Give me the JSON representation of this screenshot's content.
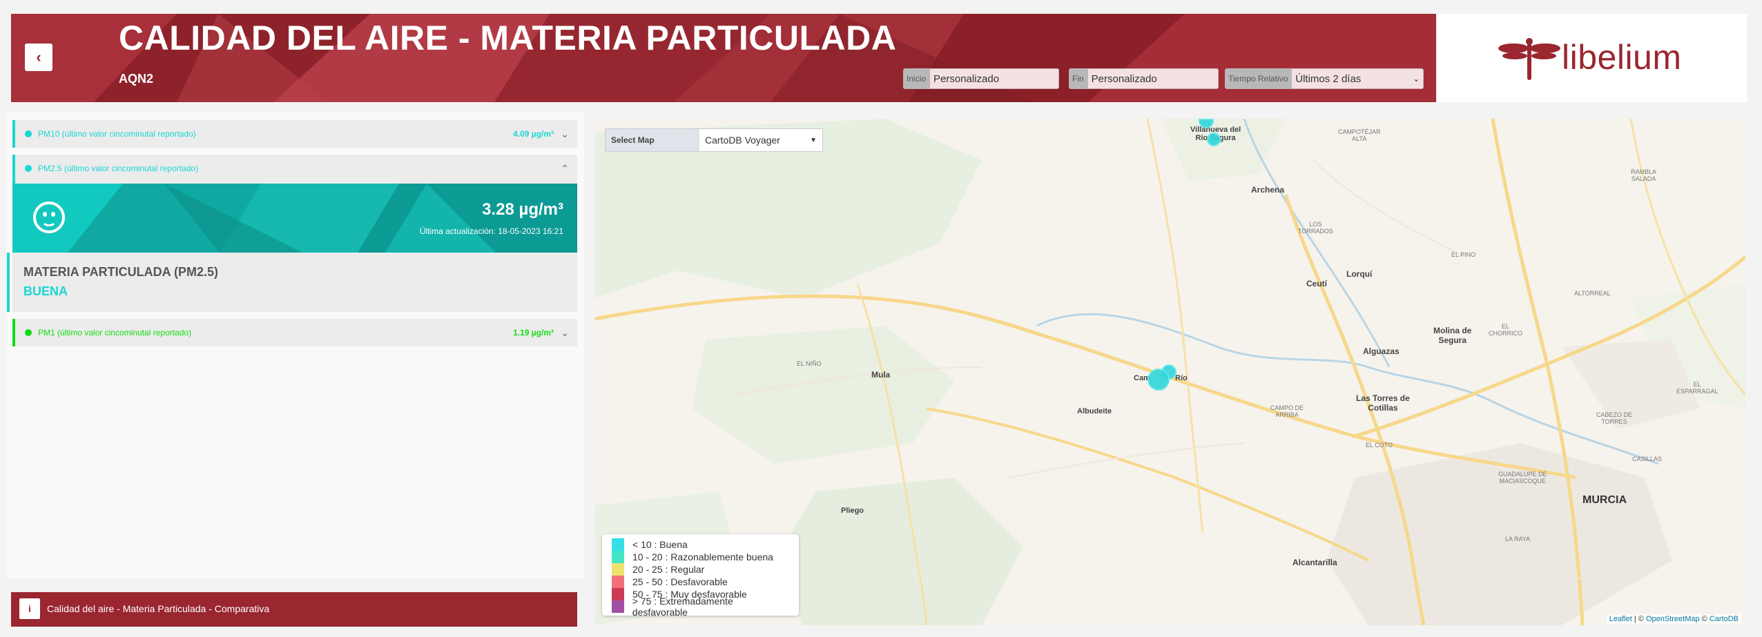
{
  "header": {
    "title": "CALIDAD DEL AIRE - MATERIA PARTICULADA",
    "subtitle": "AQN2",
    "back_icon": "‹",
    "filters": {
      "inicio_label": "Inicio",
      "inicio_value": "Personalizado",
      "fin_label": "Fin",
      "fin_value": "Personalizado",
      "relativo_label": "Tiempo Relativo",
      "relativo_value": "Últimos 2 días"
    }
  },
  "logo": {
    "text": "libelium"
  },
  "panel": {
    "pm10": {
      "label": "PM10 (último valor cincominutal reportado)",
      "value": "4.09 µg/m³",
      "color": "#19d7d2"
    },
    "pm25": {
      "label": "PM2.5 (último valor cincominutal reportado)",
      "value": "3.28 µg/m³",
      "color": "#19d7d2",
      "updated": "Última actualización: 18-05-2023 16:21",
      "info_title": "MATERIA PARTICULADA (PM2.5)",
      "info_status": "BUENA"
    },
    "pm1": {
      "label": "PM1 (último valor cincominutal reportado)",
      "value": "1.19 µg/m³",
      "color": "#11dd11"
    }
  },
  "footer": {
    "text": "Calidad del aire - Materia Particulada - Comparativa",
    "icon": "i"
  },
  "map": {
    "select_label": "Select Map",
    "select_value": "CartoDB Voyager",
    "places": {
      "villanueva": "Villanueva del",
      "riosegura": "Río Segura",
      "archena": "Archena",
      "lostorrados": "LOS\nTORRADOS",
      "lorqui": "Lorquí",
      "ceuti": "Ceutí",
      "molina": "Molina de",
      "segura": "Segura",
      "alguazas": "Alguazas",
      "torres1": "Las Torres de",
      "torres2": "Cotillas",
      "mula": "Mula",
      "elnino": "EL NIÑO",
      "albudeite": "Albudeite",
      "campos": "Cam",
      "campos2": "Río",
      "campoarriba": "CAMPO DE\nARRIBA",
      "elcoto": "EL COTO",
      "pliego": "Pliego",
      "alcantarilla": "Alcantarilla",
      "murcia": "MURCIA",
      "casillas": "CASILLAS",
      "laraya": "LA RAYA",
      "guadalupe": "GUADALUPE DE\nMACIASCOQUE",
      "cabezo": "CABEZO DE\nTORRES",
      "elesparragal": "EL\nESPARRAGAL",
      "elchorrico": "EL\nCHORRICO",
      "altorreal": "ALTORREAL",
      "elpino": "EL PINO",
      "rambla": "RAMBLA\nSALADA",
      "campotejar": "CAMPOTÉJAR\nALTA"
    },
    "legend": [
      {
        "label": "< 10 : Buena",
        "color": "#35dfe4"
      },
      {
        "label": "10 - 20 : Razonablemente buena",
        "color": "#42e6c4"
      },
      {
        "label": "20 - 25 : Regular",
        "color": "#f0e36c"
      },
      {
        "label": "25 - 50 : Desfavorable",
        "color": "#f2707a"
      },
      {
        "label": "50 - 75 : Muy desfavorable",
        "color": "#cc3a55"
      },
      {
        "label": "> 75 : Extremadamente desfavorable",
        "color": "#a250a6"
      }
    ],
    "attribution": {
      "leaflet": "Leaflet",
      "sep1": " | © ",
      "osm": "OpenStreetMap",
      "sep2": " © ",
      "carto": "CartoDB"
    }
  }
}
